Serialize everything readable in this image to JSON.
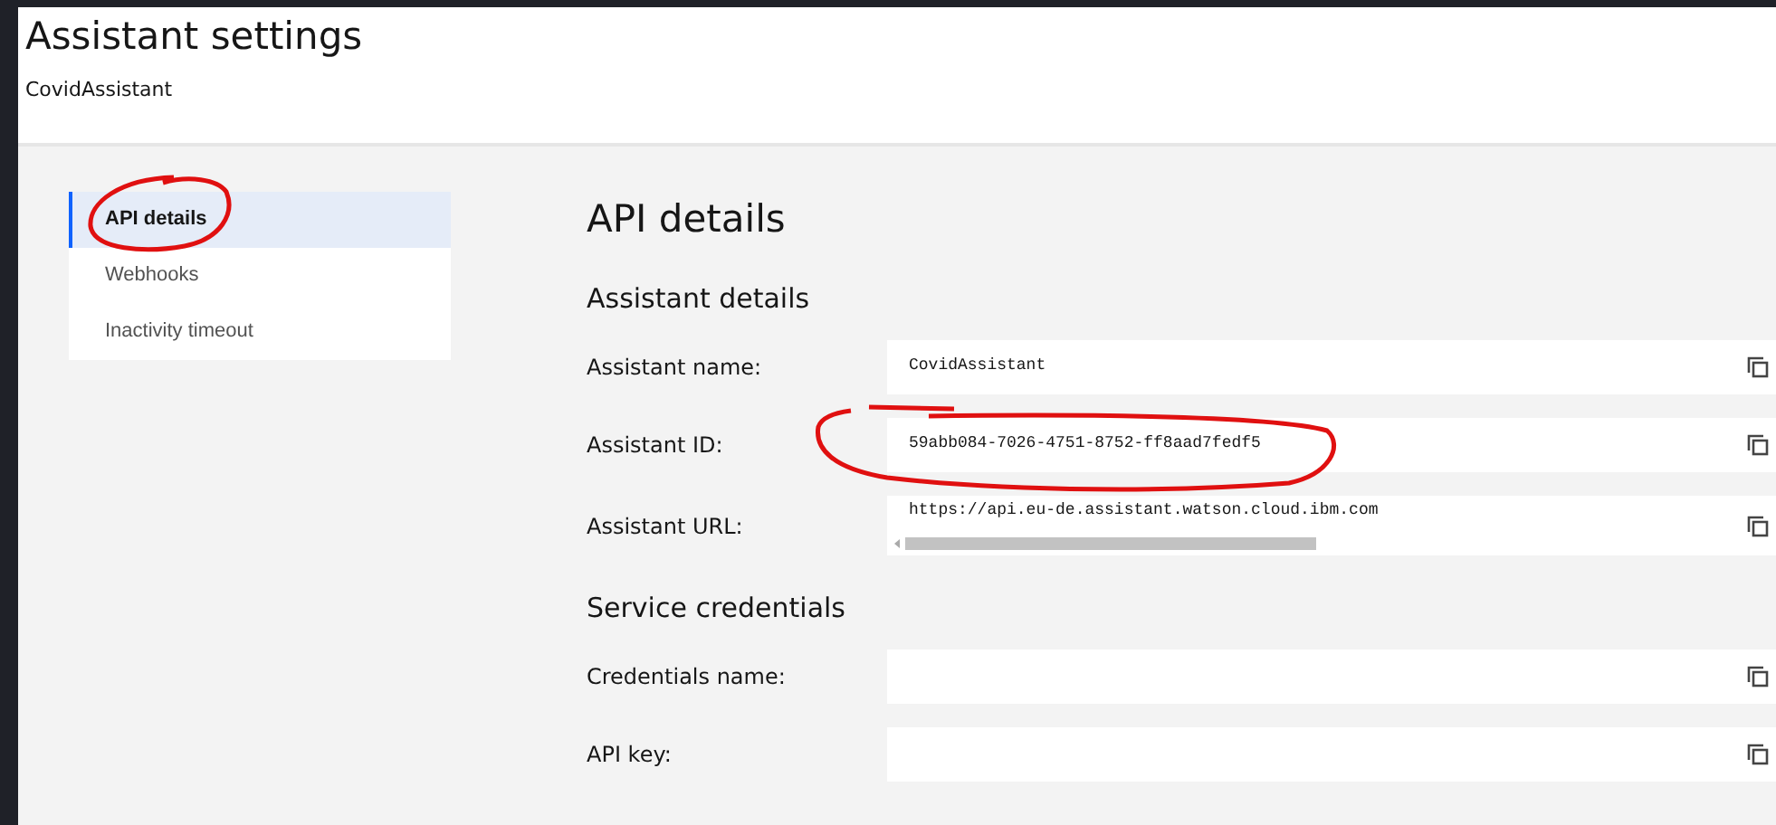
{
  "header": {
    "title": "Assistant settings",
    "subtitle": "CovidAssistant"
  },
  "sidebar": {
    "items": [
      {
        "label": "API details",
        "selected": true
      },
      {
        "label": "Webhooks",
        "selected": false
      },
      {
        "label": "Inactivity timeout",
        "selected": false
      }
    ]
  },
  "main": {
    "title": "API details",
    "sections": [
      {
        "heading": "Assistant details",
        "fields": [
          {
            "label": "Assistant name:",
            "value": "CovidAssistant"
          },
          {
            "label": "Assistant ID:",
            "value": "59abb084-7026-4751-8752-ff8aad7fedf5"
          },
          {
            "label": "Assistant URL:",
            "value": "https://api.eu-de.assistant.watson.cloud.ibm.com",
            "scrollable": true
          }
        ]
      },
      {
        "heading": "Service credentials",
        "fields": [
          {
            "label": "Credentials name:"
          },
          {
            "label": "API key:"
          }
        ]
      }
    ]
  }
}
